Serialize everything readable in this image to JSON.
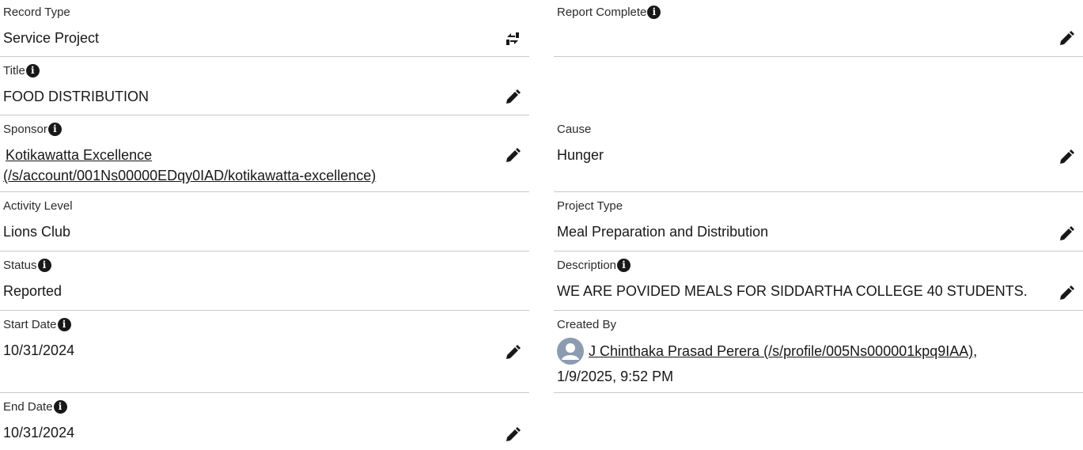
{
  "left": {
    "record_type": {
      "label": "Record Type",
      "value": "Service Project"
    },
    "title": {
      "label": "Title",
      "value": "FOOD DISTRIBUTION"
    },
    "sponsor": {
      "label": "Sponsor",
      "line1": "Kotikawatta Excellence",
      "line2": "(/s/account/001Ns00000EDqy0IAD/kotikawatta-excellence)"
    },
    "activity_level": {
      "label": "Activity Level",
      "value": "Lions Club"
    },
    "status": {
      "label": "Status",
      "value": "Reported"
    },
    "start_date": {
      "label": "Start Date",
      "value": "10/31/2024"
    },
    "end_date": {
      "label": "End Date",
      "value": "10/31/2024"
    }
  },
  "right": {
    "report_complete": {
      "label": "Report Complete",
      "value": ""
    },
    "cause": {
      "label": "Cause",
      "value": "Hunger"
    },
    "project_type": {
      "label": "Project Type",
      "value": "Meal Preparation and Distribution"
    },
    "description": {
      "label": "Description",
      "value": "WE ARE POVIDED MEALS FOR SIDDARTHA COLLEGE 40 STUDENTS."
    },
    "created_by": {
      "label": "Created By",
      "user": "J Chinthaka Prasad Perera (/s/profile/005Ns000001kpq9IAA)",
      "separator": ",",
      "date": "1/9/2025, 9:52 PM"
    }
  },
  "icons": {
    "info": "info-icon",
    "edit": "pencil-icon",
    "change": "change-record-type-icon",
    "avatar": "user-avatar-icon"
  },
  "info_glyph": "i"
}
